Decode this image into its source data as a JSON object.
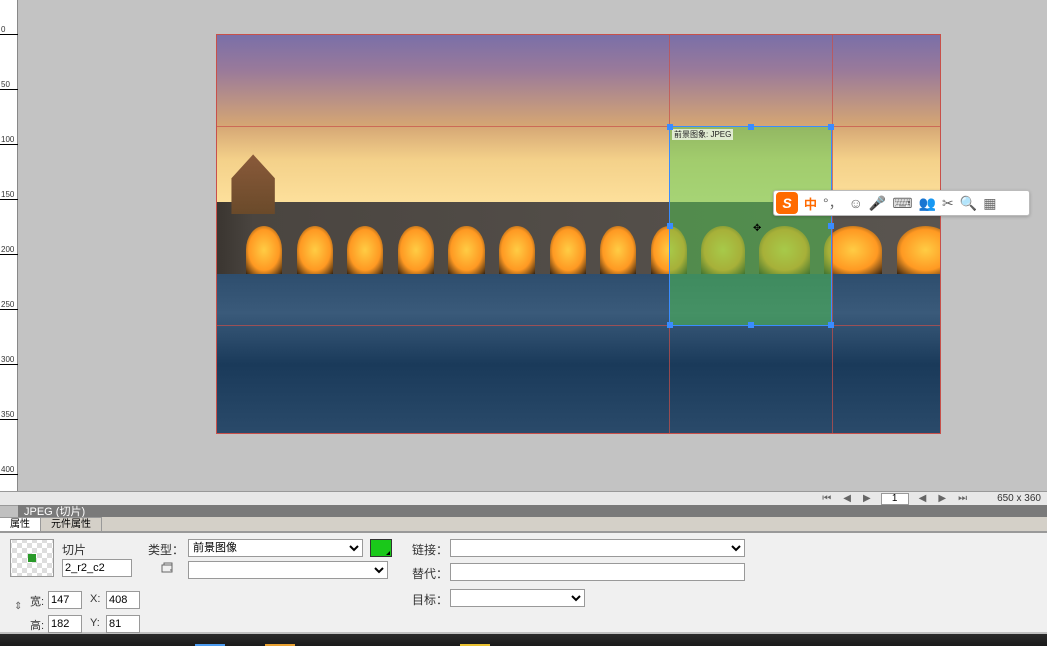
{
  "doc_label": "JPEG (切片)",
  "ruler_ticks": [
    "0",
    "50",
    "100",
    "150",
    "200",
    "250",
    "300",
    "350",
    "400"
  ],
  "slice": {
    "label_tooltip": "前景图象: JPEG"
  },
  "ime": {
    "logo": "S",
    "mode": "中",
    "items": [
      "°，",
      "☺",
      "🎤",
      "⌨",
      "👥",
      "✂",
      "🔍",
      "▦"
    ]
  },
  "frame_nav": {
    "first": "⏮",
    "prev": "◀",
    "next": "▶",
    "current": "1",
    "play_prev": "◀",
    "play_next": "▶",
    "last": "⏭",
    "dims": "650 x 360"
  },
  "tabs": {
    "props": "属性",
    "elem_props": "元件属性"
  },
  "panel": {
    "slice_heading": "切片",
    "slice_name": "2_r2_c2",
    "type_label": "类型：",
    "type_value": "前景图像",
    "link_label": "链接：",
    "link_value": "",
    "alt_label": "替代：",
    "alt_value": "",
    "target_label": "目标：",
    "target_value": "",
    "width_label": "宽:",
    "width_value": "147",
    "x_label": "X:",
    "x_value": "408",
    "height_label": "高:",
    "height_value": "182",
    "y_label": "Y:",
    "y_value": "81"
  }
}
